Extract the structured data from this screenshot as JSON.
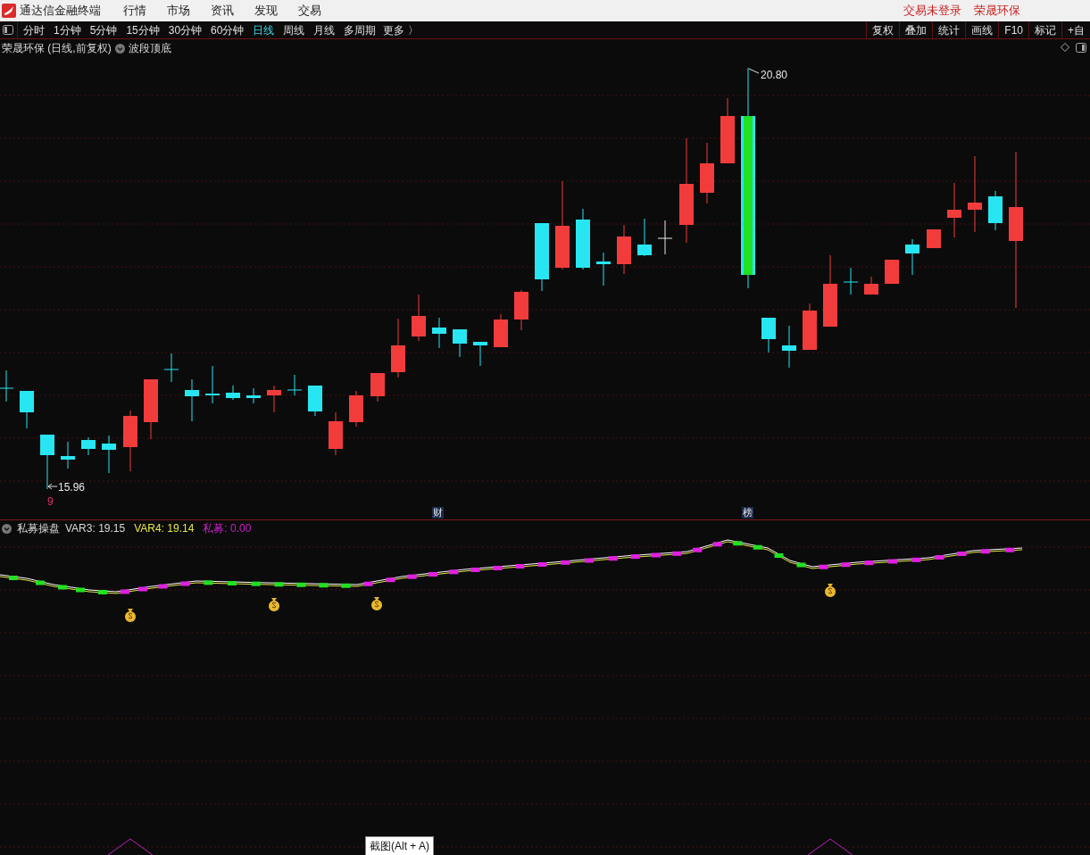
{
  "title_bar": {
    "app_name": "通达信金融终端",
    "menu": [
      "行情",
      "市场",
      "资讯",
      "发现",
      "交易"
    ],
    "login_status": "交易未登录",
    "stock_name": "荣晟环保"
  },
  "toolbar": {
    "periods": [
      {
        "label": "分时",
        "selected": false
      },
      {
        "label": "1分钟",
        "selected": false
      },
      {
        "label": "5分钟",
        "selected": false
      },
      {
        "label": "15分钟",
        "selected": false
      },
      {
        "label": "30分钟",
        "selected": false
      },
      {
        "label": "60分钟",
        "selected": false
      },
      {
        "label": "日线",
        "selected": true
      },
      {
        "label": "周线",
        "selected": false
      },
      {
        "label": "月线",
        "selected": false
      },
      {
        "label": "多周期",
        "selected": false
      }
    ],
    "more": "更多 〉",
    "tools": [
      "复权",
      "叠加",
      "统计",
      "画线",
      "F10",
      "标记",
      "+自"
    ]
  },
  "main_chart": {
    "title": "荣晟环保 (日线,前复权)",
    "indicator": "波段顶底",
    "high_label": "20.80",
    "low_label": "15.96",
    "low_marker": "9",
    "event_markers": [
      {
        "label": "财"
      },
      {
        "label": "榜"
      }
    ]
  },
  "sub_chart": {
    "name": "私募操盘",
    "values": [
      {
        "label": "VAR3: 19.15",
        "color": "#d8d8d8"
      },
      {
        "label": "VAR4: 19.14",
        "color": "#e6e64a"
      },
      {
        "label": "私募: 0.00",
        "color": "#c822c8"
      }
    ]
  },
  "tooltip": "截图(Alt + A)"
}
